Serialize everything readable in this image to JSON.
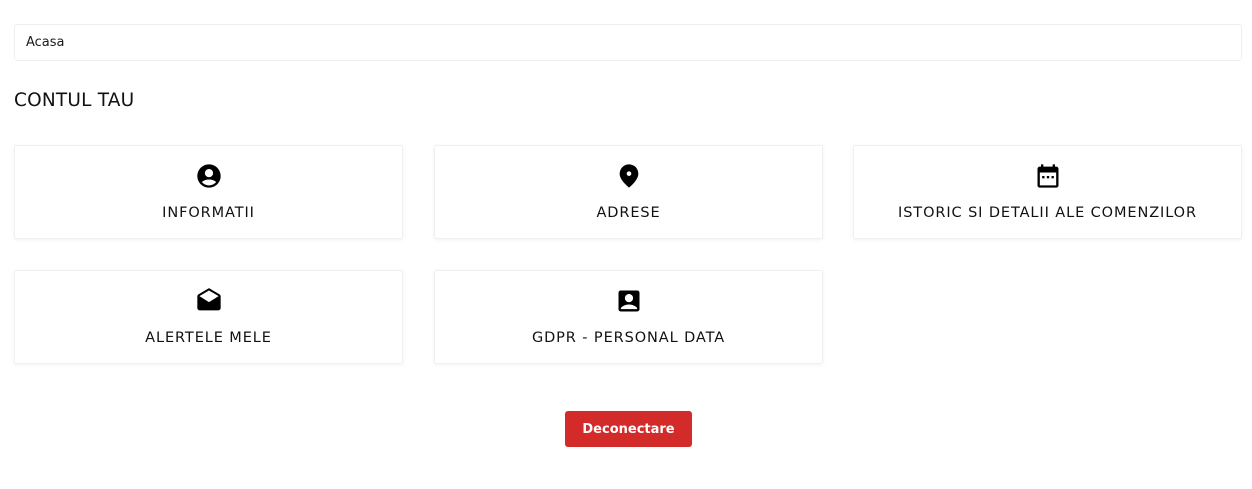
{
  "breadcrumb": {
    "home_label": "Acasa"
  },
  "page": {
    "title": "CONTUL TAU"
  },
  "cards": [
    {
      "label": "INFORMATII",
      "icon": "account-circle-icon"
    },
    {
      "label": "ADRESE",
      "icon": "location-pin-icon"
    },
    {
      "label": "ISTORIC SI DETALII ALE COMENZILOR",
      "icon": "calendar-icon"
    },
    {
      "label": "ALERTELE MELE",
      "icon": "open-envelope-icon"
    },
    {
      "label": "GDPR - PERSONAL DATA",
      "icon": "contact-card-icon"
    }
  ],
  "logout": {
    "label": "Deconectare"
  },
  "colors": {
    "logout_background": "#d32a2a",
    "text": "#111111",
    "border": "#eeeeee"
  }
}
